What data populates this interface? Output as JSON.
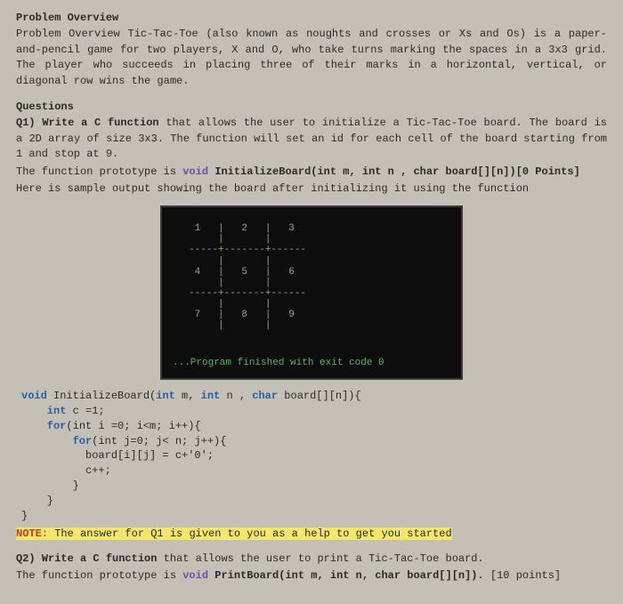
{
  "h1": "Problem Overview",
  "p1": "Problem Overview Tic-Tac-Toe (also known as noughts and crosses or Xs and Os) is a paper-and-pencil game for two players, X and O, who take turns marking the spaces in a 3x3 grid. The player who succeeds in placing three of their marks in a horizontal, vertical, or diagonal row wins the game.",
  "h2": "Questions",
  "q1_a": "Q1) Write a C function",
  "q1_b": " that allows the user to initialize a Tic-Tac-Toe board. The board is a 2D array of size 3x3. The function will set an id for each cell of the board starting from 1 and stop at 9.",
  "proto_pre": "The function prototype is ",
  "proto_void": "void",
  "proto_sig": " InitializeBoard(int m, int n , char board[][n])",
  "proto_points": "[0 Points]",
  "sample": "Here is sample output showing the board after initializing it using the function",
  "term_grid": " 1   |   2   |   3\n     |       |    \n-----+-------+------\n     |       |    \n 4   |   5   |   6\n     |       |    \n-----+-------+------\n     |       |    \n 7   |   8   |   9\n     |       |    ",
  "term_exit": "...Program finished with exit code 0",
  "code_l1a": "void",
  "code_l1b": " InitializeBoard(",
  "code_l1c": "int",
  "code_l1d": " m, ",
  "code_l1e": "int",
  "code_l1f": " n , ",
  "code_l1g": "char",
  "code_l1h": " board[][n]){",
  "code_l2a": "    int",
  "code_l2b": " c =1;",
  "code_l3a": "    for",
  "code_l3b": "(int i =0; i<m; i++){",
  "code_l4a": "        for",
  "code_l4b": "(int j=0; j< n; j++){",
  "code_l5": "          board[i][j] = c+'0';",
  "code_l6": "          c++;",
  "code_l7": "        }",
  "code_l8": "    }",
  "code_l9": "}",
  "note_label": "NOTE:",
  "note_text": " The answer for Q1 is given to you as a help to get you started",
  "q2_a": "Q2) Write a C function",
  "q2_b": " that allows the user to print a Tic-Tac-Toe board.",
  "q2_proto_pre": "The function prototype is ",
  "q2_proto_void": "void",
  "q2_proto_sig": " PrintBoard(int m, int n, char board[][n]). ",
  "q2_points": "[10 points]"
}
